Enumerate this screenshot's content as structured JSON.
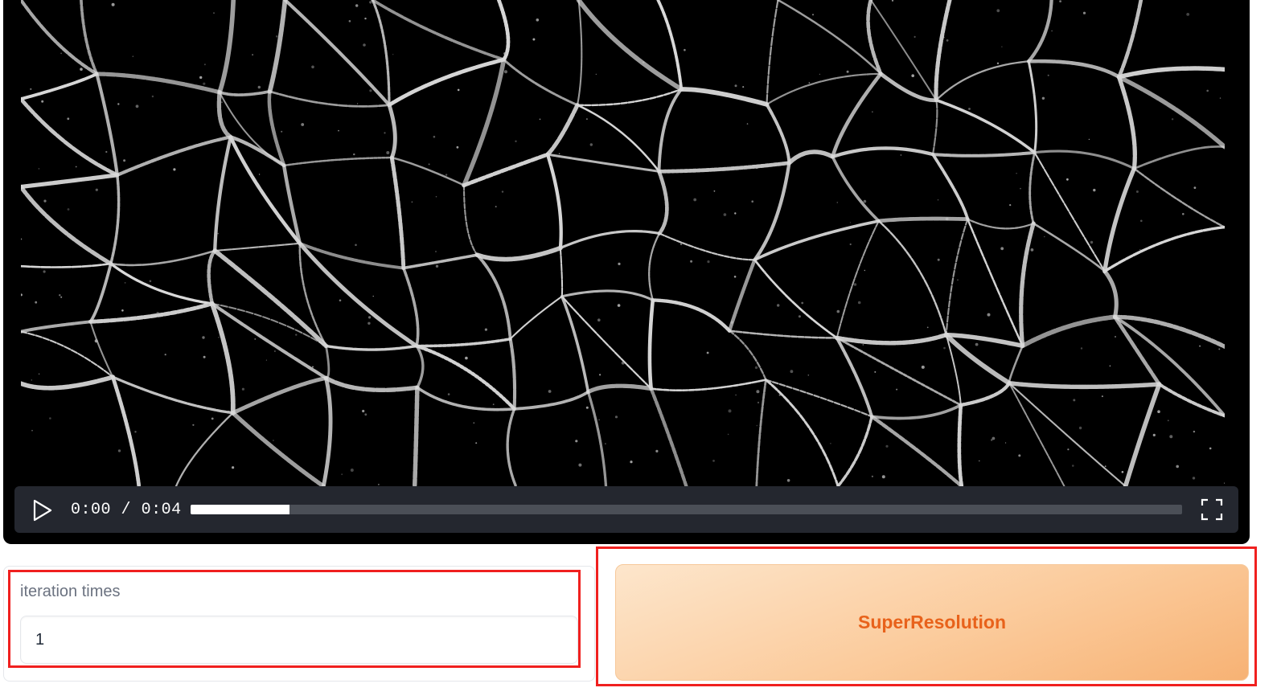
{
  "video": {
    "current_time": "0:00",
    "separator": "/",
    "duration": "0:04",
    "buffered_fraction": 0.1,
    "played_fraction": 0.0
  },
  "icons": {
    "play": "play-icon",
    "fullscreen": "fullscreen-icon"
  },
  "iteration": {
    "label": "iteration times",
    "value": "1"
  },
  "action": {
    "button_label": "SuperResolution"
  },
  "colors": {
    "annotation_red": "#f0201f",
    "button_text": "#e8621b",
    "controls_bg": "#24272f"
  }
}
